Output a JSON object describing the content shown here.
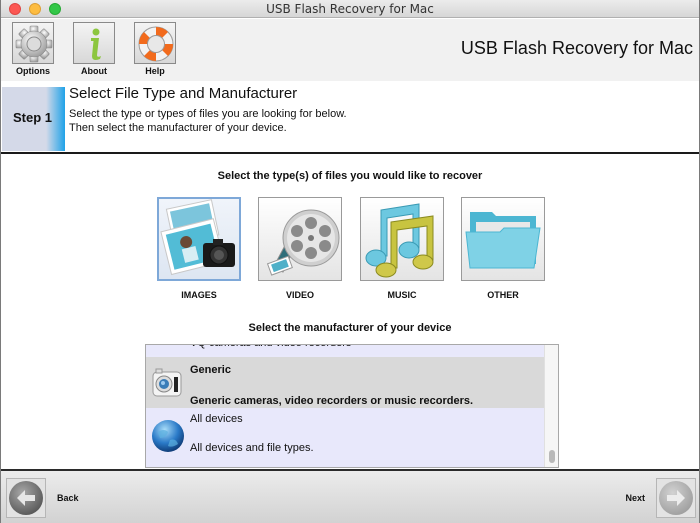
{
  "window": {
    "title": "USB Flash Recovery for Mac"
  },
  "toolbar": {
    "items": [
      {
        "label": "Options",
        "icon": "gear-icon"
      },
      {
        "label": "About",
        "icon": "info-icon"
      },
      {
        "label": "Help",
        "icon": "lifebuoy-icon"
      }
    ],
    "brand_title": "USB Flash Recovery for Mac"
  },
  "step": {
    "tab_label": "Step 1",
    "title": "Select File Type and Manufacturer",
    "desc_line1": "Select the type or types of files you are looking for below.",
    "desc_line2": "Then select the manufacturer of your device."
  },
  "file_types": {
    "heading": "Select the type(s) of files you would like to recover",
    "items": [
      {
        "label": "IMAGES",
        "icon": "images-icon",
        "selected": true
      },
      {
        "label": "VIDEO",
        "icon": "film-reel-icon",
        "selected": false
      },
      {
        "label": "MUSIC",
        "icon": "music-notes-icon",
        "selected": false
      },
      {
        "label": "OTHER",
        "icon": "folder-icon",
        "selected": false
      }
    ]
  },
  "manufacturers": {
    "heading": "Select the manufacturer of your device",
    "rows": [
      {
        "name": "",
        "desc": "VQ cameras and video recorders",
        "icon": "",
        "selected": false
      },
      {
        "name": "Generic",
        "desc": "Generic cameras, video recorders or music recorders.",
        "icon": "camera-icon",
        "selected": true
      },
      {
        "name": "All devices",
        "desc": "All devices and file types.",
        "icon": "globe-icon",
        "selected": false
      }
    ]
  },
  "navigation": {
    "back_label": "Back",
    "next_label": "Next"
  },
  "colors": {
    "step_accent": "#1fa2e8",
    "selection_border": "#7ea8d8",
    "list_background": "#e9e9fb",
    "selected_row": "#d9d9d9"
  }
}
